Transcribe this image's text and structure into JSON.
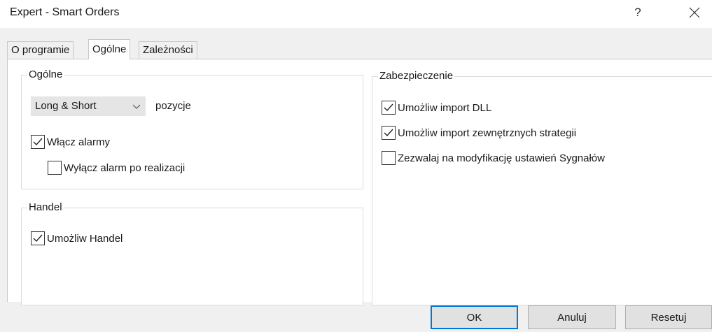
{
  "window": {
    "title": "Expert - Smart Orders",
    "help_label": "?"
  },
  "tabs": [
    {
      "label": "O programie",
      "active": false
    },
    {
      "label": "Ogólne",
      "active": true
    },
    {
      "label": "Zależności",
      "active": false
    }
  ],
  "general": {
    "group_label": "Ogólne",
    "position_select": {
      "value": "Long & Short",
      "suffix": "pozycje"
    },
    "alarms": {
      "label": "Włącz alarmy",
      "checked": true
    },
    "alarm_after": {
      "label": "Wyłącz alarm po realizacji",
      "checked": false
    }
  },
  "trade": {
    "group_label": "Handel",
    "enable_trade": {
      "label": "Umożliw Handel",
      "checked": true
    }
  },
  "security": {
    "group_label": "Zabezpieczenie",
    "dll_import": {
      "label": "Umożliw import DLL",
      "checked": true
    },
    "external_import": {
      "label": "Umożliw import zewnętrznych strategii",
      "checked": true
    },
    "signal_mod": {
      "label": "Zezwalaj na modyfikację ustawień Sygnałów",
      "checked": false
    }
  },
  "buttons": {
    "ok": "OK",
    "cancel": "Anuluj",
    "reset": "Resetuj"
  },
  "colors": {
    "accent": "#0078d7"
  }
}
